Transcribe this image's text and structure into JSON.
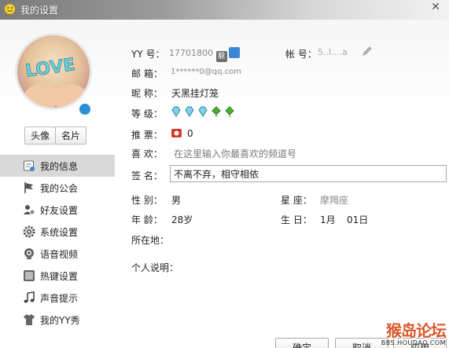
{
  "window": {
    "title": "我的设置",
    "close_glyph": "✕"
  },
  "sidebar": {
    "avatar_alt": "LOVE",
    "buttons": [
      {
        "label": "头像"
      },
      {
        "label": "名片"
      }
    ],
    "items": [
      {
        "label": "我的信息",
        "icon": "profile-card-icon",
        "active": true
      },
      {
        "label": "我的公会",
        "icon": "flag-icon",
        "active": false
      },
      {
        "label": "好友设置",
        "icon": "user-settings-icon",
        "active": false
      },
      {
        "label": "系统设置",
        "icon": "gear-icon",
        "active": false
      },
      {
        "label": "语音视频",
        "icon": "webcam-icon",
        "active": false
      },
      {
        "label": "热键设置",
        "icon": "keyboard-icon",
        "active": false
      },
      {
        "label": "声音提示",
        "icon": "music-note-icon",
        "active": false
      },
      {
        "label": "我的YY秀",
        "icon": "shirt-icon",
        "active": false
      }
    ]
  },
  "profile": {
    "yy_label": "YY  号：",
    "yy_number": "17701800",
    "vip_badge": "靓",
    "account_label": "帐  号：",
    "account_value": "5..l....a",
    "email_label": "邮  箱：",
    "email_value": "1******0@qq.com",
    "nickname_label": "昵  称：",
    "nickname_value": "天黑挂灯笼",
    "level_label": "等  级：",
    "level_icons": [
      "diamond",
      "diamond",
      "diamond",
      "leaf",
      "leaf"
    ],
    "votes_label": "推  票：",
    "votes_value": "0",
    "like_label": "喜  欢：",
    "like_placeholder": "在这里输入你最喜欢的频道号",
    "signature_label": "签  名：",
    "signature_value": "不离不弃，相守相依",
    "gender_label": "性  别：",
    "gender_value": "男",
    "zodiac_label": "星  座：",
    "zodiac_value": "摩羯座",
    "age_label": "年  龄：",
    "age_value": "28岁",
    "birthday_label": "生  日：",
    "birthday_month": "1月",
    "birthday_day": "01日",
    "location_label": "所在地：",
    "description_label": "个人说明："
  },
  "footer": {
    "ok_label": "确定",
    "cancel_label": "取消",
    "apply_label": "应用"
  },
  "watermark": {
    "brand": "猴岛论坛",
    "url": "BBS.HOUDAO.COM"
  },
  "colors": {
    "active_nav": "#d9d9d9",
    "accent_blue": "#3a87d3",
    "diamond": "#2fa8c8",
    "leaf": "#3f9a2a",
    "ticket_red": "#d83a2a"
  }
}
